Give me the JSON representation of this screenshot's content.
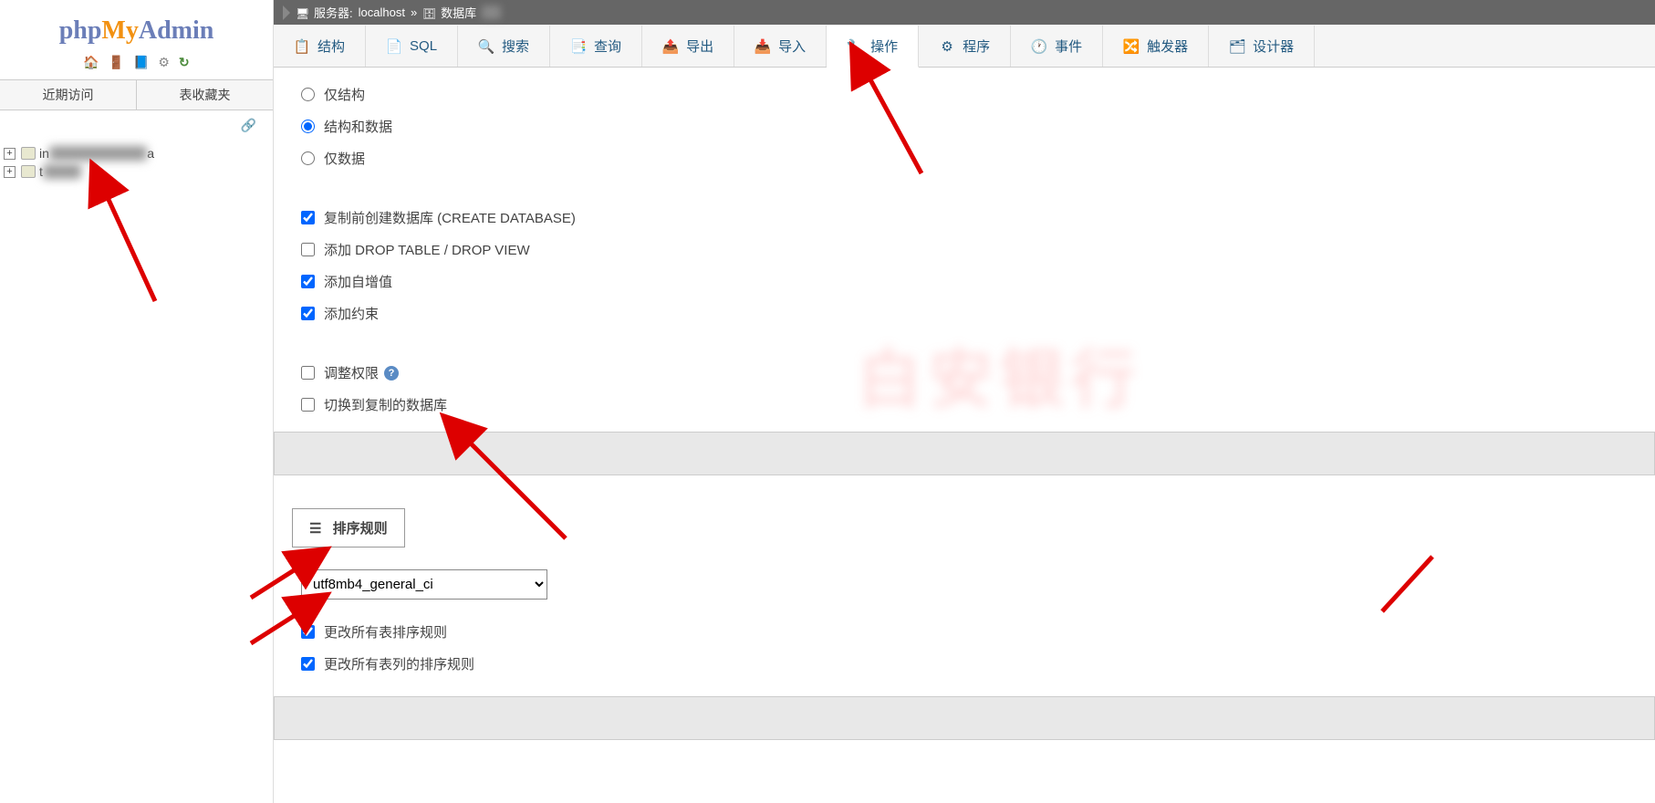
{
  "logo": {
    "php": "php",
    "my": "My",
    "admin": "Admin"
  },
  "sidebar": {
    "tabs": [
      "近期访问",
      "表收藏夹"
    ],
    "dbs": [
      {
        "prefix": "in",
        "suffix": "a",
        "blurred": "formation_schem"
      },
      {
        "prefix": "t",
        "suffix": "",
        "blurred": "est_db"
      }
    ]
  },
  "breadcrumb": {
    "server_label": "服务器:",
    "server": "localhost",
    "sep": "»",
    "db_label": "数据库",
    "db_blur": "test"
  },
  "tabs": [
    {
      "label": "结构",
      "icon": "i-struct"
    },
    {
      "label": "SQL",
      "icon": "i-sql"
    },
    {
      "label": "搜索",
      "icon": "i-search"
    },
    {
      "label": "查询",
      "icon": "i-query"
    },
    {
      "label": "导出",
      "icon": "i-export"
    },
    {
      "label": "导入",
      "icon": "i-import"
    },
    {
      "label": "操作",
      "icon": "i-wrench",
      "active": true
    },
    {
      "label": "程序",
      "icon": "i-proc"
    },
    {
      "label": "事件",
      "icon": "i-event"
    },
    {
      "label": "触发器",
      "icon": "i-trigger"
    },
    {
      "label": "设计器",
      "icon": "i-design"
    }
  ],
  "radios": {
    "structure_only": "仅结构",
    "structure_and_data": "结构和数据",
    "data_only": "仅数据",
    "selected": "structure_and_data"
  },
  "checks": {
    "create_db": {
      "label": "复制前创建数据库 (CREATE DATABASE)",
      "checked": true
    },
    "drop_table": {
      "label": "添加 DROP TABLE / DROP VIEW",
      "checked": false
    },
    "auto_increment": {
      "label": "添加自增值",
      "checked": true
    },
    "constraints": {
      "label": "添加约束",
      "checked": true
    },
    "adjust_priv": {
      "label": "调整权限",
      "checked": false,
      "help": true
    },
    "switch_to": {
      "label": "切换到复制的数据库",
      "checked": false
    }
  },
  "collation": {
    "title": "排序规则",
    "value": "utf8mb4_general_ci",
    "change_tables": {
      "label": "更改所有表排序规则",
      "checked": true
    },
    "change_columns": {
      "label": "更改所有表列的排序规则",
      "checked": true
    }
  }
}
